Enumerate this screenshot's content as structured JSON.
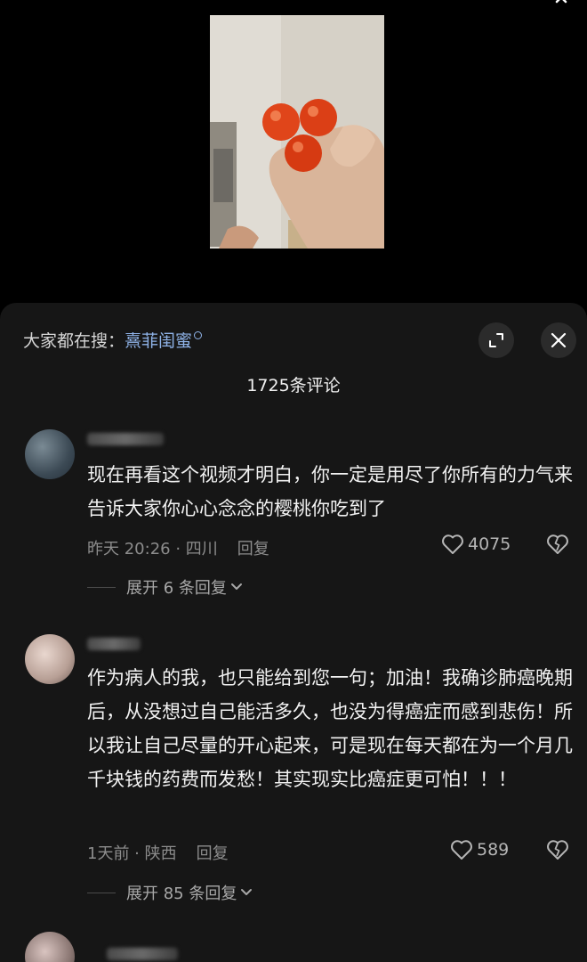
{
  "search_hint": {
    "prefix": "大家都在搜：",
    "keyword": "熹菲闺蜜"
  },
  "comments_header": {
    "count_label": "1725条评论"
  },
  "comments": [
    {
      "text": "现在再看这个视频才明白，你一定是用尽了你所有的力气来告诉大家你心心念念的樱桃你吃到了",
      "meta": "昨天 20:26 · 四川",
      "reply_label": "回复",
      "likes": "4075",
      "expand_label": "展开 6 条回复"
    },
    {
      "text": "作为病人的我，也只能给到您一句；加油！我确诊肺癌晚期后，从没想过自己能活多久，也没为得癌症而感到悲伤！所以我让自己尽量的开心起来，可是现在每天都在为一个月几千块钱的药费而发愁！其实现实比癌症更可怕！！！",
      "meta": "1天前 · 陕西",
      "reply_label": "回复",
      "likes": "589",
      "expand_label": "展开 85 条回复"
    }
  ],
  "colors": {
    "sheet_bg": "#161616",
    "keyword": "#8fb3e8",
    "meta": "#8c8c8c"
  }
}
